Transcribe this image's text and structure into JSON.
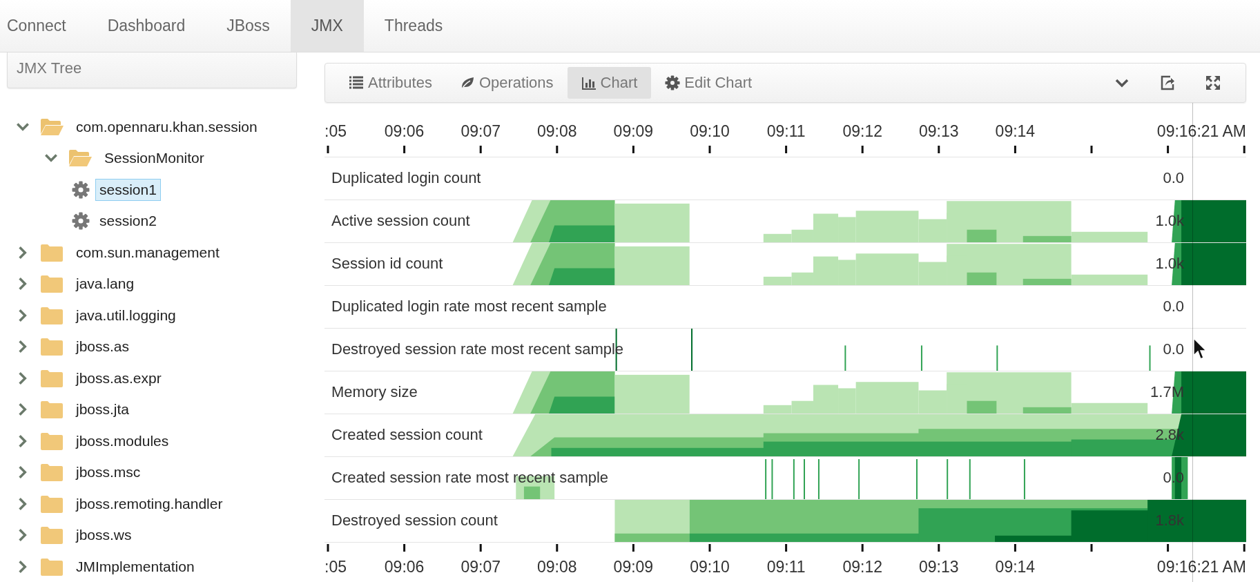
{
  "tabs": [
    {
      "label": "Connect",
      "selected": false
    },
    {
      "label": "Dashboard",
      "selected": false
    },
    {
      "label": "JBoss",
      "selected": false
    },
    {
      "label": "JMX",
      "selected": true
    },
    {
      "label": "Threads",
      "selected": false
    }
  ],
  "tree_panel": {
    "title": "JMX Tree"
  },
  "tree": [
    {
      "label": "com.opennaru.khan.session",
      "kind": "folder",
      "expanded": true,
      "selected": false,
      "children": [
        {
          "label": "SessionMonitor",
          "kind": "folder",
          "expanded": true,
          "selected": false,
          "children": [
            {
              "label": "session1",
              "kind": "mbean",
              "selected": true
            },
            {
              "label": "session2",
              "kind": "mbean",
              "selected": false
            }
          ]
        }
      ]
    },
    {
      "label": "com.sun.management",
      "kind": "folder",
      "expanded": false,
      "selected": false
    },
    {
      "label": "java.lang",
      "kind": "folder",
      "expanded": false,
      "selected": false
    },
    {
      "label": "java.util.logging",
      "kind": "folder",
      "expanded": false,
      "selected": false
    },
    {
      "label": "jboss.as",
      "kind": "folder",
      "expanded": false,
      "selected": false
    },
    {
      "label": "jboss.as.expr",
      "kind": "folder",
      "expanded": false,
      "selected": false
    },
    {
      "label": "jboss.jta",
      "kind": "folder",
      "expanded": false,
      "selected": false
    },
    {
      "label": "jboss.modules",
      "kind": "folder",
      "expanded": false,
      "selected": false
    },
    {
      "label": "jboss.msc",
      "kind": "folder",
      "expanded": false,
      "selected": false
    },
    {
      "label": "jboss.remoting.handler",
      "kind": "folder",
      "expanded": false,
      "selected": false
    },
    {
      "label": "jboss.ws",
      "kind": "folder",
      "expanded": false,
      "selected": false
    },
    {
      "label": "JMImplementation",
      "kind": "folder",
      "expanded": false,
      "selected": false
    }
  ],
  "toolbar": [
    {
      "label": "Attributes",
      "kind": "list",
      "selected": false
    },
    {
      "label": "Operations",
      "kind": "leaf",
      "selected": false
    },
    {
      "label": "Chart",
      "kind": "chart",
      "selected": true
    },
    {
      "label": "Edit Chart",
      "kind": "gear",
      "selected": false
    }
  ],
  "top_axis": {
    "labels": [
      ":05",
      "09:06",
      "09:07",
      "09:08",
      "09:09",
      "09:10",
      "09:11",
      "09:12",
      "09:13",
      "09:14"
    ],
    "now_label": "09:16:21 AM"
  },
  "metrics": [
    {
      "name": "Duplicated login count",
      "value": "0.0",
      "kind": "empty"
    },
    {
      "name": "Active session count",
      "value": "1.0k",
      "kind": "steps"
    },
    {
      "name": "Session id count",
      "value": "1.0k",
      "kind": "steps"
    },
    {
      "name": "Duplicated login rate most recent sample",
      "value": "0.0",
      "kind": "empty"
    },
    {
      "name": "Destroyed session rate most recent sample",
      "value": "0.0",
      "kind": "spikes"
    },
    {
      "name": "Memory size",
      "value": "1.7M",
      "kind": "steps"
    },
    {
      "name": "Created session count",
      "value": "2.8k",
      "kind": "ramp"
    },
    {
      "name": "Created session rate most recent sample",
      "value": "0.0",
      "kind": "bursts"
    },
    {
      "name": "Destroyed session count",
      "value": "1.8k",
      "kind": "blocks"
    }
  ],
  "bottom_axis": {
    "labels": [
      ":05",
      "09:06",
      "09:07",
      "09:08",
      "09:09",
      "09:10",
      "09:11",
      "09:12",
      "09:13",
      "09:14"
    ],
    "now_label": "09:16:21 AM"
  }
}
